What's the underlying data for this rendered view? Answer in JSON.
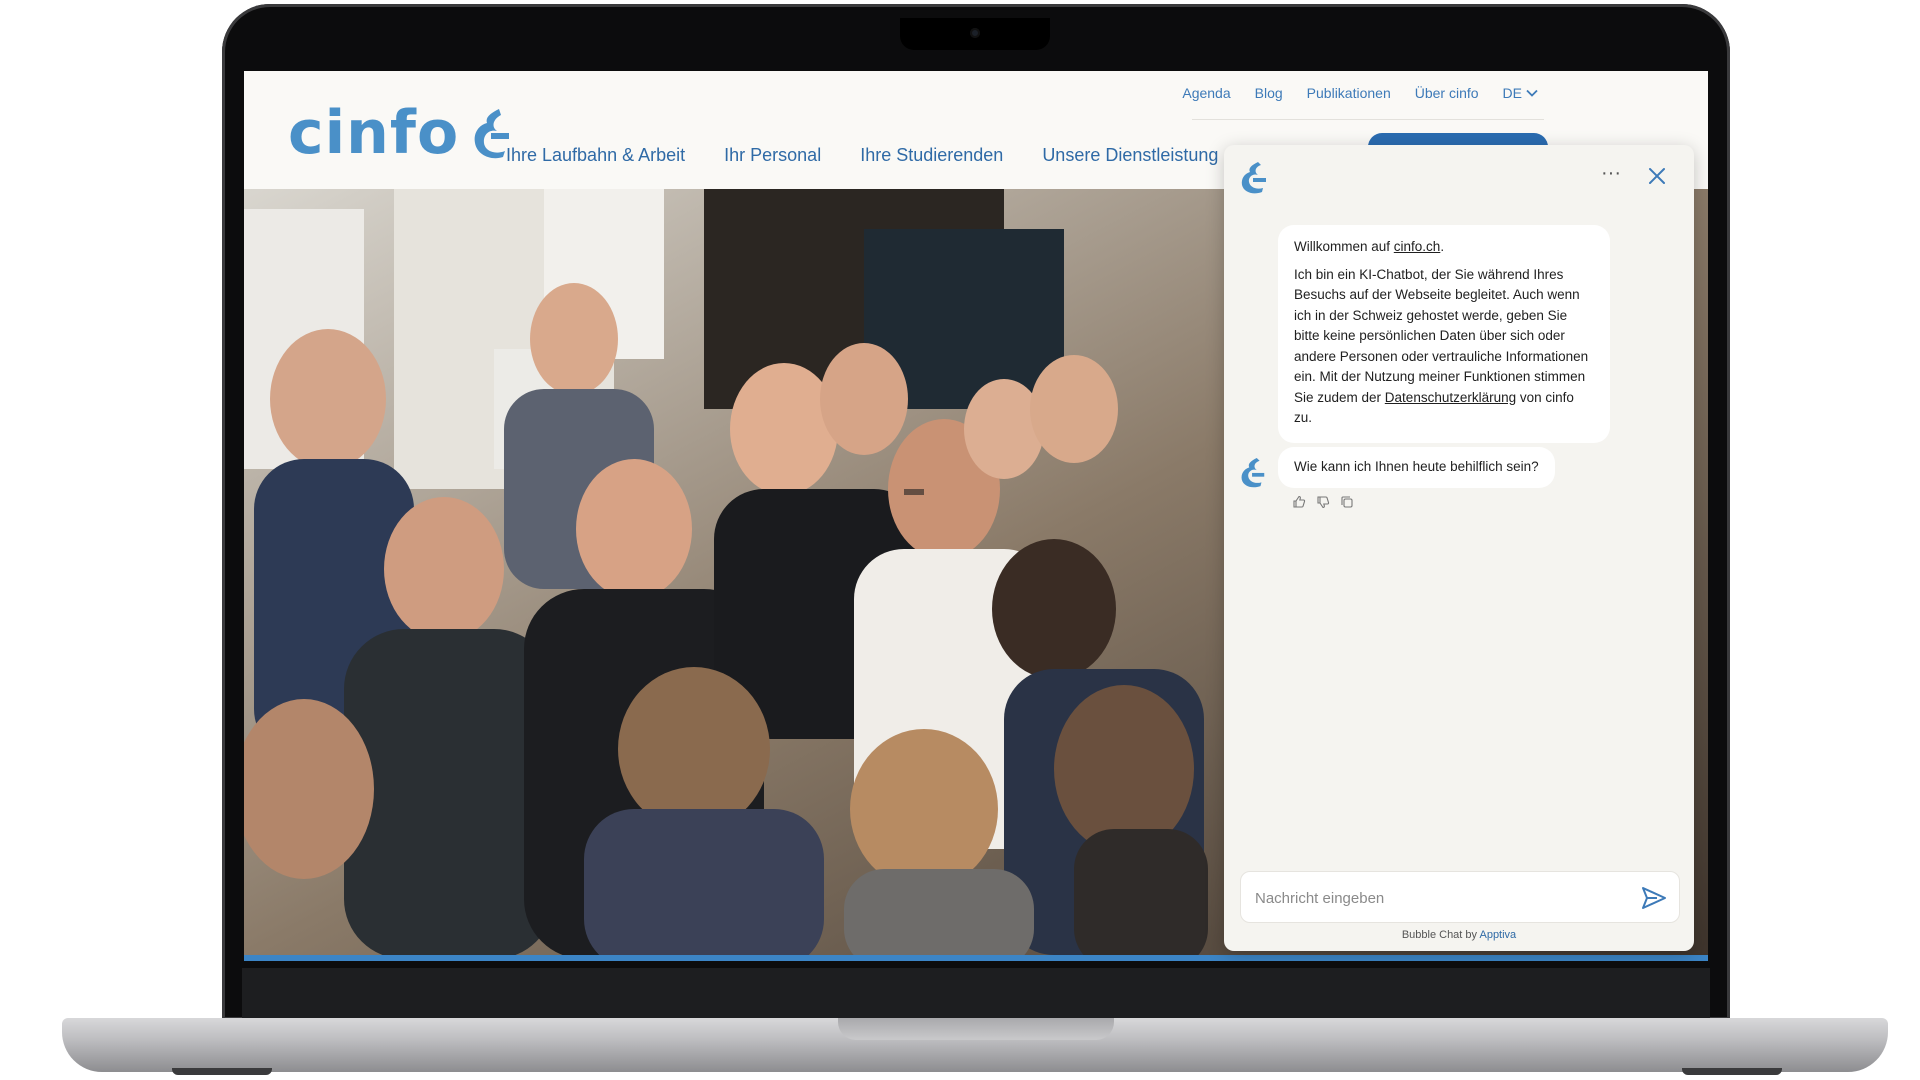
{
  "site": {
    "logo_text": "cinfo",
    "top_nav": [
      "Agenda",
      "Blog",
      "Publikationen",
      "Über cinfo"
    ],
    "language": "DE",
    "main_nav": [
      "Ihre Laufbahn & Arbeit",
      "Ihr Personal",
      "Ihre Studierenden",
      "Unsere Dienstleistung"
    ]
  },
  "chat": {
    "more_icon": "more-horizontal-icon",
    "close_icon": "close-icon",
    "welcome_prefix": "Willkommen auf ",
    "welcome_link": "cinfo.ch",
    "welcome_suffix": ".",
    "intro_text": "Ich bin ein KI-Chatbot, der Sie während Ihres Besuchs auf der Webseite begleitet. Auch wenn ich in der Schweiz gehostet werde, geben Sie bitte keine persönlichen Daten über sich oder andere Personen oder vertrauliche Informationen ein. Mit der Nutzung meiner Funktionen stimmen Sie zudem der ",
    "privacy_link": "Datenschutzerklärung",
    "intro_suffix": " von cinfo zu.",
    "question": "Wie kann ich Ihnen heute behilflich sein?",
    "input_placeholder": "Nachricht eingeben",
    "input_value": "",
    "footer_prefix": "Bubble Chat by ",
    "footer_brand": "Apptiva"
  },
  "colors": {
    "brand_blue": "#4a90c8",
    "nav_blue": "#2f6aa6",
    "progress_blue": "#3c85c6",
    "page_bg": "#faf9f6",
    "chat_bg": "#f5f4f0"
  }
}
